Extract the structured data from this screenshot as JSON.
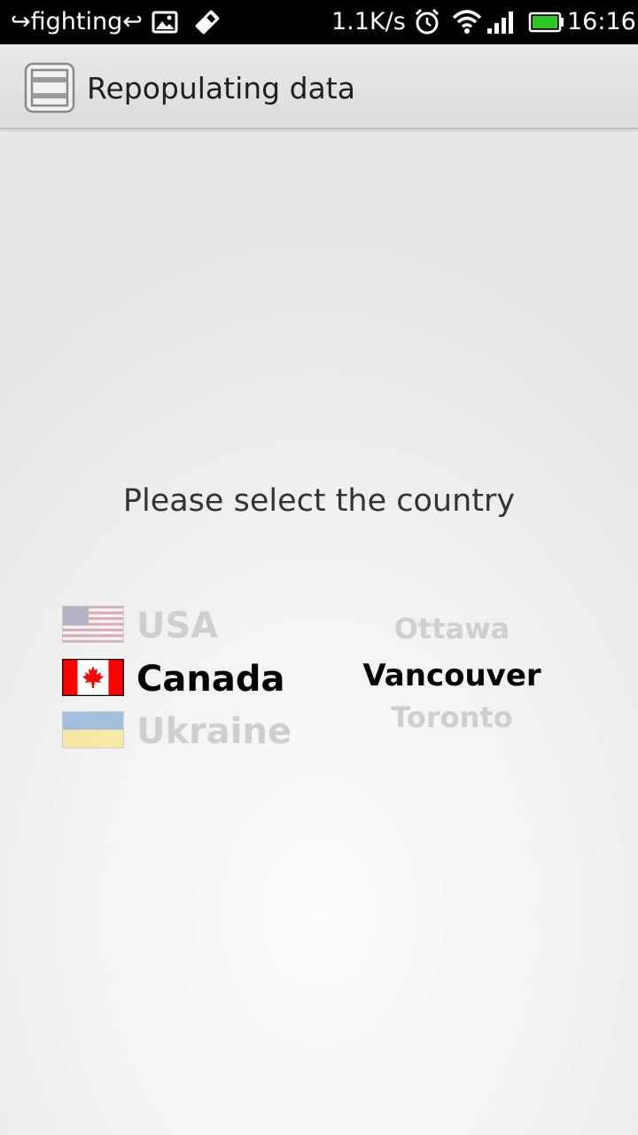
{
  "status_bar": {
    "notification_text": "↪fighting↩",
    "network_speed": "1.1K/s",
    "time": "16:16",
    "icons": [
      "image-icon",
      "usb-debug-icon",
      "alarm-icon",
      "wifi-icon",
      "signal-icon",
      "battery-icon"
    ]
  },
  "action_bar": {
    "title": "Repopulating data",
    "icon": "app-icon"
  },
  "main": {
    "prompt": "Please select the country",
    "countries": [
      {
        "label": "USA",
        "flag": "usa-flag-icon",
        "selected": false
      },
      {
        "label": "Canada",
        "flag": "canada-flag-icon",
        "selected": true
      },
      {
        "label": "Ukraine",
        "flag": "ukraine-flag-icon",
        "selected": false
      }
    ],
    "cities": [
      {
        "label": "Ottawa",
        "selected": false
      },
      {
        "label": "Vancouver",
        "selected": true
      },
      {
        "label": "Toronto",
        "selected": false
      }
    ]
  },
  "colors": {
    "selected_text": "#000000",
    "dim_text": "#cfcfcf",
    "battery_green": "#2dc826",
    "canada_red": "#ff0000",
    "ukraine_blue": "#0057b7",
    "ukraine_yellow": "#ffd700"
  }
}
